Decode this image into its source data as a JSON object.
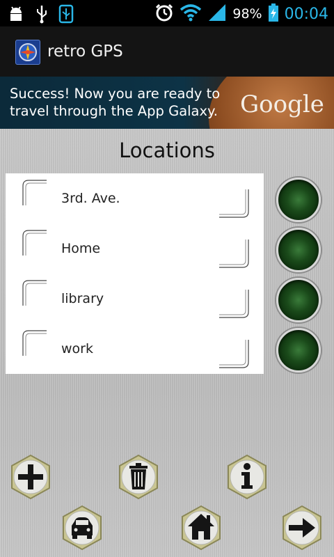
{
  "status_bar": {
    "battery": "98%",
    "time": "00:04",
    "icons": [
      "android-debug-icon",
      "usb-icon",
      "usb-storage-icon",
      "alarm-icon",
      "wifi-icon",
      "signal-icon",
      "battery-charging-icon"
    ]
  },
  "app": {
    "title": "retro GPS",
    "icon": "compass-app-icon"
  },
  "ad": {
    "line1": "Success! Now you are ready to",
    "line2": "travel through the App Galaxy.",
    "brand": "Google"
  },
  "main": {
    "heading": "Locations",
    "locations": [
      {
        "label": "3rd. Ave."
      },
      {
        "label": "Home"
      },
      {
        "label": "library"
      },
      {
        "label": "work"
      }
    ],
    "indicator_color": "#1a4a1a"
  },
  "toolbar": {
    "buttons": [
      {
        "name": "add-button",
        "icon": "plus-icon"
      },
      {
        "name": "delete-button",
        "icon": "trash-icon"
      },
      {
        "name": "info-button",
        "icon": "info-icon"
      },
      {
        "name": "car-button",
        "icon": "car-icon"
      },
      {
        "name": "home-button",
        "icon": "home-icon"
      },
      {
        "name": "next-button",
        "icon": "arrow-right-icon"
      }
    ]
  },
  "colors": {
    "status_bar_bg": "#000000",
    "title_bar_bg": "#141414",
    "time_accent": "#2ab7e8",
    "metal_bg": "#c8c8c8",
    "hex_button_rim": "#c9c592"
  }
}
